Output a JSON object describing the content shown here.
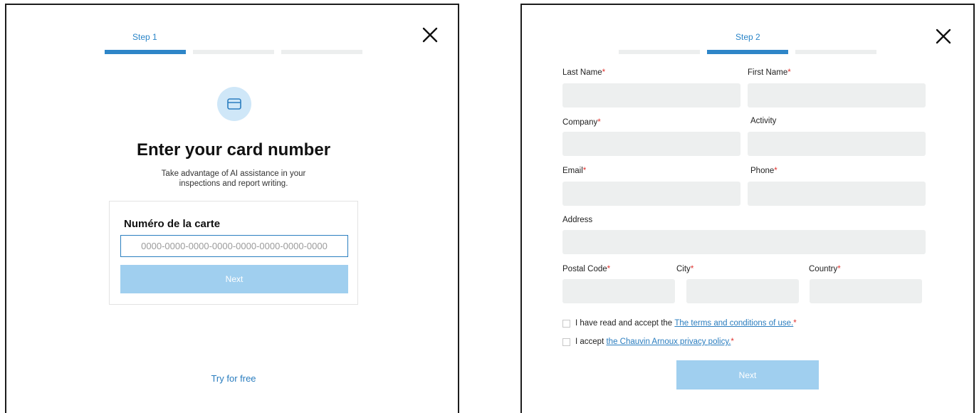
{
  "step1": {
    "step_label": "Step 1",
    "title": "Enter your card number",
    "subtitle_line1": "Take advantage of AI assistance in your",
    "subtitle_line2": "inspections and report writing.",
    "card_field_label": "Numéro de la carte",
    "card_placeholder": "0000-0000-0000-0000-0000-0000-0000-0000",
    "next_label": "Next",
    "try_free_label": "Try for free",
    "active_step": 1,
    "total_steps": 3
  },
  "step2": {
    "step_label": "Step 2",
    "active_step": 2,
    "total_steps": 3,
    "fields": {
      "last_name": "Last Name",
      "first_name": "First Name",
      "company": "Company",
      "activity": "Activity",
      "email": "Email",
      "phone": "Phone",
      "address": "Address",
      "postal_code": "Postal Code",
      "city": "City",
      "country": "Country"
    },
    "required_mark": "*",
    "terms_prefix": "I have read and accept the ",
    "terms_link": "The terms and conditions of use.",
    "privacy_prefix": "I accept ",
    "privacy_link": "the Chauvin Arnoux privacy policy.",
    "next_label": "Next"
  },
  "icons": {
    "close": "close-icon",
    "card": "credit-card-icon"
  },
  "colors": {
    "accent": "#2e86c8",
    "button_disabled": "#a0cfef",
    "field_bg": "#edefef",
    "required": "#e0332f",
    "link": "#2a7dbf"
  }
}
